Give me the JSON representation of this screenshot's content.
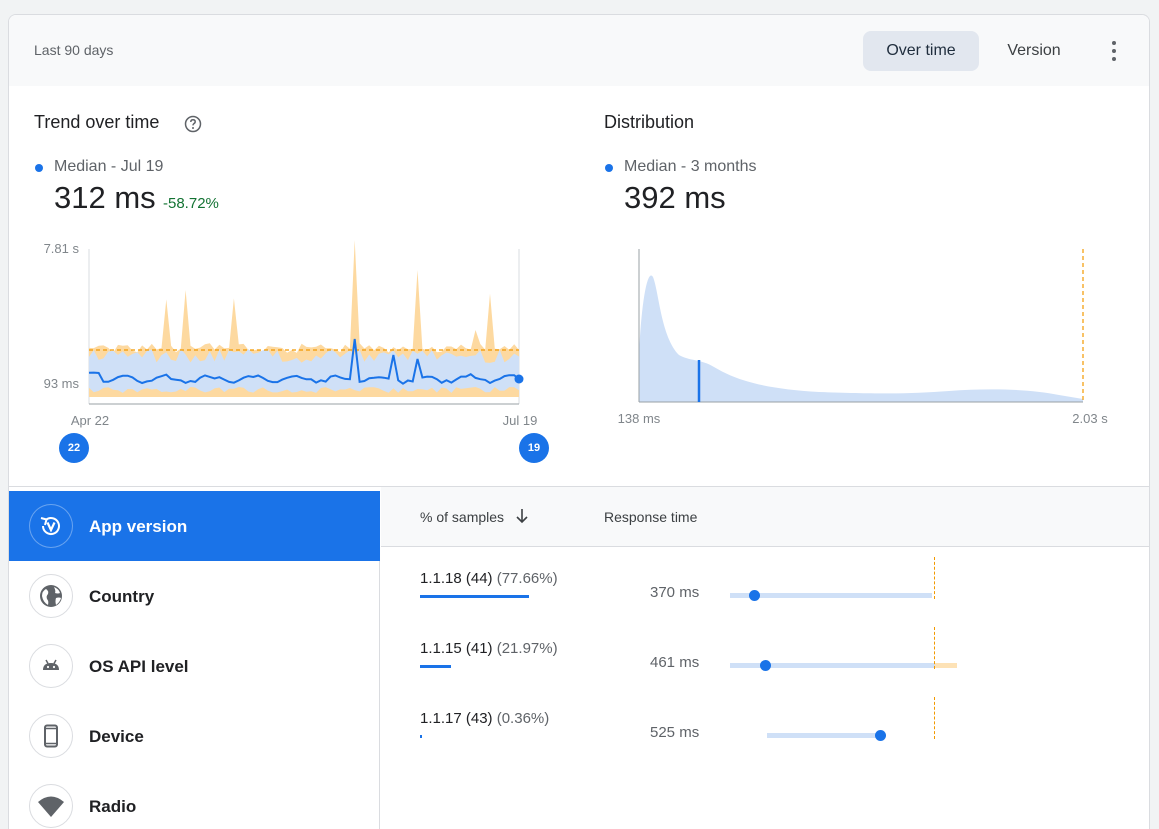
{
  "header": {
    "range_label": "Last 90 days",
    "tabs": [
      {
        "label": "Over time",
        "active": true
      },
      {
        "label": "Version",
        "active": false
      }
    ]
  },
  "trend": {
    "title": "Trend over time",
    "legend_label": "Median - Jul 19",
    "value": "312 ms",
    "delta": "-58.72%",
    "y_top_label": "7.81 s",
    "y_mid_label": "93 ms",
    "x_start_label": "Apr 22",
    "x_end_label": "Jul 19",
    "start_pill": "22",
    "end_pill": "19"
  },
  "distribution": {
    "title": "Distribution",
    "legend_label": "Median - 3 months",
    "value": "392 ms",
    "x_start_label": "138 ms",
    "x_end_label": "2.03 s"
  },
  "dimensions": [
    {
      "label": "App version",
      "icon": "app-version-icon",
      "active": true
    },
    {
      "label": "Country",
      "icon": "globe-icon",
      "active": false
    },
    {
      "label": "OS API level",
      "icon": "android-icon",
      "active": false
    },
    {
      "label": "Device",
      "icon": "phone-icon",
      "active": false
    },
    {
      "label": "Radio",
      "icon": "wifi-icon",
      "active": false
    }
  ],
  "table": {
    "col_samples": "% of samples",
    "col_response": "Response time",
    "rows": [
      {
        "version": "1.1.18 (44)",
        "pct": "(77.66%)",
        "share": 0.7766,
        "response": "370 ms"
      },
      {
        "version": "1.1.15 (41)",
        "pct": "(21.97%)",
        "share": 0.2197,
        "response": "461 ms"
      },
      {
        "version": "1.1.17 (43)",
        "pct": "(0.36%)",
        "share": 0.0036,
        "response": "525 ms"
      }
    ]
  },
  "colors": {
    "accent": "#1a73e8",
    "band": "#cfe0f7",
    "p90": "#fdd9a0",
    "threshold": "#f29900",
    "positive": "#137333"
  }
}
